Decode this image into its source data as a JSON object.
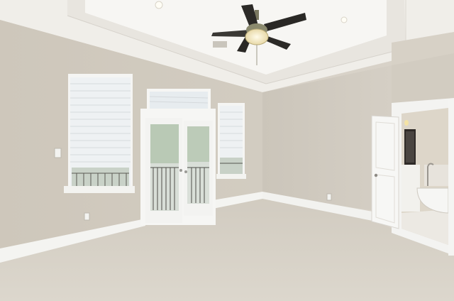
{
  "scene": {
    "subject": "empty bedroom",
    "colors": {
      "wall": "#cfc8bc",
      "wall_shadow": "#c4bcb0",
      "ceiling": "#f1efea",
      "tray_ceiling": "#f6f5f2",
      "carpet": "#d8d2c6",
      "trim": "#f4f4f2",
      "window_light": "#e9eef2",
      "fan_blade": "#2a2825",
      "fan_blade_light": "#8b8a6e",
      "bath_wall": "#ddd6c9"
    }
  }
}
